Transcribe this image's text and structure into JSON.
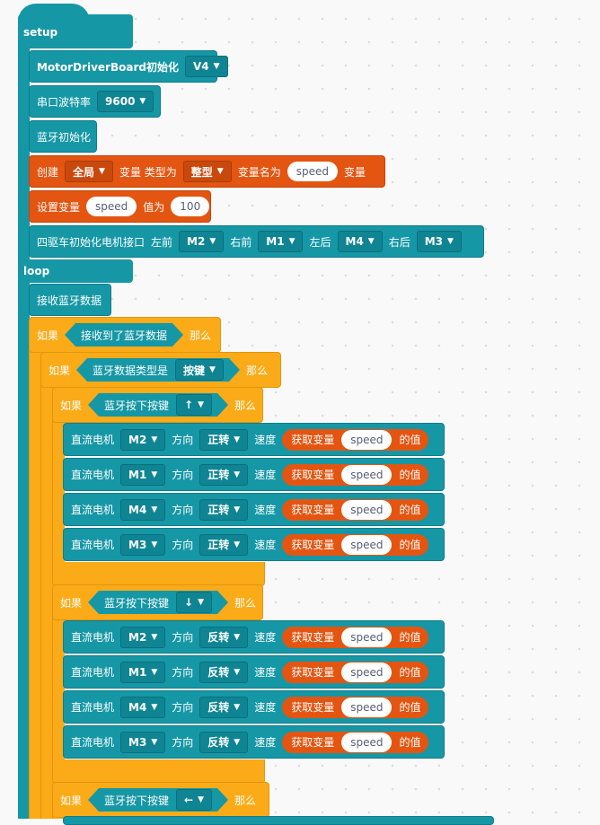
{
  "setup": {
    "label": "setup",
    "board": {
      "label": "MotorDriverBoard初始化",
      "value": "V4"
    },
    "serial": {
      "label": "串口波特率",
      "value": "9600"
    },
    "bt_init": "蓝牙初始化",
    "create_var": {
      "create": "创建",
      "scope": "全局",
      "var_type_label": "变量 类型为",
      "type": "整型",
      "name_label": "变量名为",
      "name": "speed",
      "suffix": "变量"
    },
    "set_var": {
      "label": "设置变量",
      "name": "speed",
      "value_label": "值为",
      "value": "100"
    },
    "motor_init": {
      "label": "四驱车初始化电机接口",
      "fl_label": "左前",
      "fl": "M2",
      "fr_label": "右前",
      "fr": "M1",
      "rl_label": "左后",
      "rl": "M4",
      "rr_label": "右后",
      "rr": "M3"
    }
  },
  "loop": {
    "label": "loop",
    "receive": "接收蓝牙数据",
    "if_label": "如果",
    "then_label": "那么",
    "cond_received": "接收到了蓝牙数据",
    "cond_type": {
      "label": "蓝牙数据类型是",
      "value": "按键"
    },
    "key_label": "蓝牙按下按键",
    "keys": [
      "↑",
      "↓",
      "←"
    ],
    "motor": {
      "label": "直流电机",
      "dir_label": "方向",
      "speed_label": "速度",
      "get_label": "获取变量",
      "var": "speed",
      "value_suffix": "的值"
    },
    "group_up": [
      {
        "motor": "M2",
        "dir": "正转"
      },
      {
        "motor": "M1",
        "dir": "正转"
      },
      {
        "motor": "M4",
        "dir": "正转"
      },
      {
        "motor": "M3",
        "dir": "正转"
      }
    ],
    "group_down": [
      {
        "motor": "M2",
        "dir": "反转"
      },
      {
        "motor": "M1",
        "dir": "反转"
      },
      {
        "motor": "M4",
        "dir": "反转"
      },
      {
        "motor": "M3",
        "dir": "反转"
      }
    ]
  },
  "colors": {
    "teal": "#1697a6",
    "orange": "#e35511",
    "yellow": "#fbab18",
    "background": "#f9f9f9"
  },
  "icons": {
    "caret": "dropdown-caret-icon"
  }
}
